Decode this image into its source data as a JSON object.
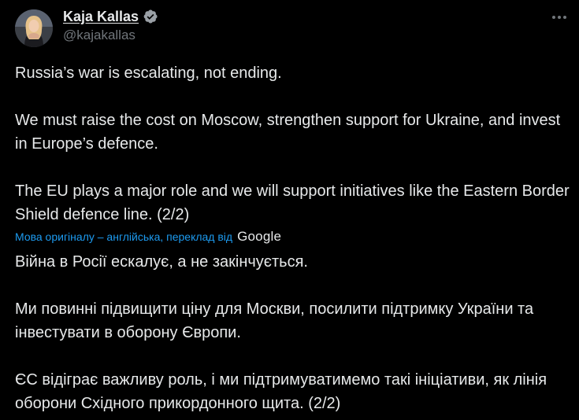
{
  "author": {
    "display_name": "Kaja Kallas",
    "handle": "@kajakallas",
    "verified": true
  },
  "tweet": {
    "text": "Russia’s war is escalating, not ending.\n\nWe must raise the cost on Moscow, strengthen support for Ukraine, and invest in Europe’s defence.\n\nThe EU plays a major role and we will support initiatives like the Eastern Border Shield defence line. (2/2)"
  },
  "translation": {
    "note": "Мова оригіналу – англійська, переклад від",
    "provider": "Google",
    "text": "Війна в Росії ескалує, а не закінчується.\n\nМи повинні підвищити ціну для Москви, посилити підтримку України та інвестувати в оборону Європи.\n\nЄС відіграє важливу роль, і ми підтримуватимемо такі ініціативи, як лінія оборони Східного прикордонного щита. (2/2)"
  },
  "icons": {
    "avatar": "avatar-photo",
    "verified": "verified-badge-icon",
    "more": "more-options-icon"
  },
  "colors": {
    "background": "#000000",
    "text": "#e7e9ea",
    "muted": "#71767b",
    "accent": "#1d9bf0"
  }
}
